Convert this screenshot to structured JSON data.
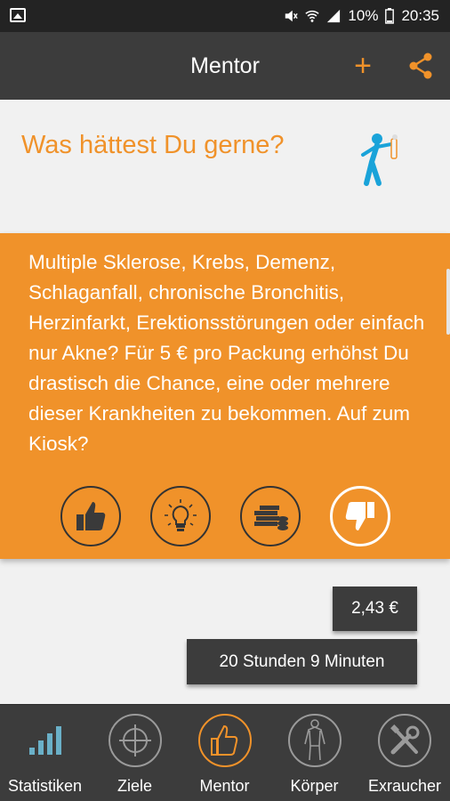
{
  "status_bar": {
    "battery": "10%",
    "time": "20:35",
    "icons": [
      "gallery-icon",
      "mute-icon",
      "wifi-icon",
      "signal-icon",
      "battery-icon"
    ]
  },
  "header": {
    "title": "Mentor",
    "add_icon": "plus-icon",
    "share_icon": "share-icon"
  },
  "question": {
    "text": "Was hättest Du gerne?",
    "figure_icon": "person-icon"
  },
  "card": {
    "message": "Multiple Sklerose, Krebs, Demenz, Schlaganfall, chronische Bronchitis, Herzinfarkt, Erektionsstörungen oder einfach nur Akne? Für 5 € pro Packung erhöhst Du drastisch die Chance, eine oder mehrere dieser Krankheiten zu bekommen. Auf zum Kiosk?",
    "actions": [
      {
        "icon": "thumbs-up-icon",
        "selected": false
      },
      {
        "icon": "lightbulb-icon",
        "selected": false
      },
      {
        "icon": "money-icon",
        "selected": false
      },
      {
        "icon": "thumbs-down-icon",
        "selected": true
      }
    ]
  },
  "bubbles": {
    "amount": "2,43 €",
    "duration": "20 Stunden 9 Minuten"
  },
  "nav": {
    "items": [
      {
        "label": "Statistiken",
        "icon": "bar-chart-icon",
        "active": false
      },
      {
        "label": "Ziele",
        "icon": "crosshair-icon",
        "active": false
      },
      {
        "label": "Mentor",
        "icon": "thumbs-up-icon",
        "active": true
      },
      {
        "label": "Körper",
        "icon": "body-icon",
        "active": false
      },
      {
        "label": "Exraucher",
        "icon": "tools-icon",
        "active": false
      }
    ]
  },
  "colors": {
    "accent": "#f0922a",
    "dark": "#3c3c3c",
    "background": "#f1f1f1",
    "figure_blue": "#1aa3d9"
  }
}
